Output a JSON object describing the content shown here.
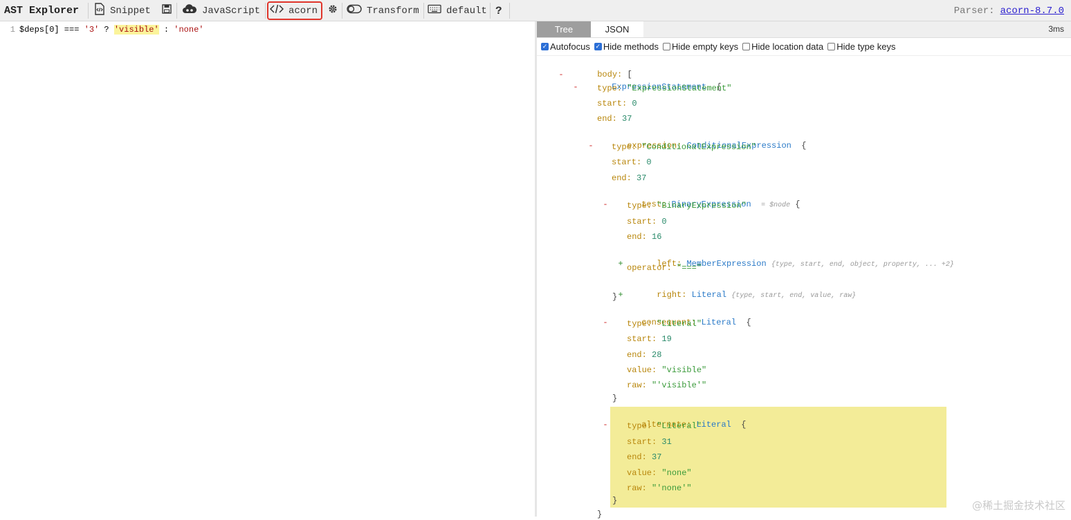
{
  "toolbar": {
    "app_title": "AST Explorer",
    "snippet_label": "Snippet",
    "language_label": "JavaScript",
    "parser_button_label": "acorn",
    "transform_label": "Transform",
    "keymap_label": "default",
    "help_label": "?",
    "parser_caption": "Parser:",
    "parser_version": "acorn-8.7.0",
    "icons": {
      "snippet": "snippet-icon",
      "save": "save-icon",
      "language": "cloud-icon",
      "parser": "code-icon",
      "settings": "gear-icon",
      "transform": "toggle-icon",
      "keymap": "keyboard-icon",
      "help": "help-icon"
    }
  },
  "editor": {
    "line_number": "1",
    "code_parts": [
      "$deps[0] === ",
      "'3'",
      " ? ",
      "'visible'",
      " : ",
      "'none'"
    ]
  },
  "output": {
    "tabs": [
      "Tree",
      "JSON"
    ],
    "active_tab": "Tree",
    "timing": "3ms",
    "options": [
      {
        "label": "Autofocus",
        "checked": true
      },
      {
        "label": "Hide methods",
        "checked": true
      },
      {
        "label": "Hide empty keys",
        "checked": false
      },
      {
        "label": "Hide location data",
        "checked": false
      },
      {
        "label": "Hide type keys",
        "checked": false
      }
    ]
  },
  "tree": {
    "body_key": "body:",
    "body_bracket": "[",
    "expr_stmt_type": "ExpressionStatement",
    "expr_stmt_brace": "{",
    "type_key": "type:",
    "start_key": "start:",
    "end_key": "end:",
    "expr_stmt_type_val": "\"ExpressionStatement\"",
    "expr_stmt_start": "0",
    "expr_stmt_end": "37",
    "expression_key": "expression:",
    "cond_type": "ConditionalExpression",
    "cond_type_val": "\"ConditionalExpression\"",
    "cond_start": "0",
    "cond_end": "37",
    "test_key": "test:",
    "bin_type": "BinaryExpression",
    "node_hint": "= $node",
    "bin_type_val": "\"BinaryExpression\"",
    "bin_start": "0",
    "bin_end": "16",
    "left_key": "left:",
    "member_type": "MemberExpression",
    "member_summary": "{type, start, end, object, property, ... +2}",
    "operator_key": "operator:",
    "operator_val": "\"===\"",
    "right_key": "right:",
    "literal_type": "Literal",
    "literal_summary": "{type, start, end, value, raw}",
    "close_brace": "}",
    "consequent_key": "consequent:",
    "literal_type_val": "\"Literal\"",
    "cons_start": "19",
    "cons_end": "28",
    "value_key": "value:",
    "raw_key": "raw:",
    "cons_value": "\"visible\"",
    "cons_raw": "\"'visible'\"",
    "alternate_key": "alternate:",
    "alt_start": "31",
    "alt_end": "37",
    "alt_value": "\"none\"",
    "alt_raw": "\"'none'\"",
    "collapse_sign": "-",
    "expand_sign": "+"
  },
  "watermark": "@稀土掘金技术社区"
}
